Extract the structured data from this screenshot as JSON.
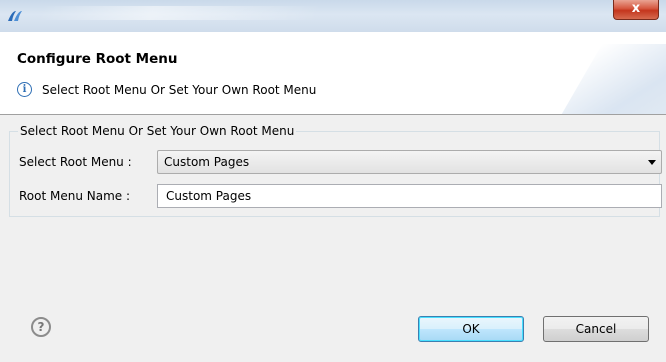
{
  "window": {
    "close_symbol": "x"
  },
  "header": {
    "title": "Configure Root Menu",
    "info_symbol": "i",
    "info_message": "Select Root Menu Or Set Your Own Root Menu"
  },
  "group": {
    "legend": "Select Root Menu Or Set Your Own Root Menu",
    "select_label": "Select Root Menu :",
    "select_value": "Custom Pages",
    "name_label": "Root Menu Name :",
    "name_value": "Custom Pages"
  },
  "footer": {
    "help_symbol": "?",
    "ok_label": "OK",
    "cancel_label": "Cancel"
  },
  "icons": {
    "app": "app-logo-icon",
    "close": "close-icon",
    "info": "info-icon",
    "help": "help-icon",
    "dropdown": "chevron-down-icon"
  }
}
